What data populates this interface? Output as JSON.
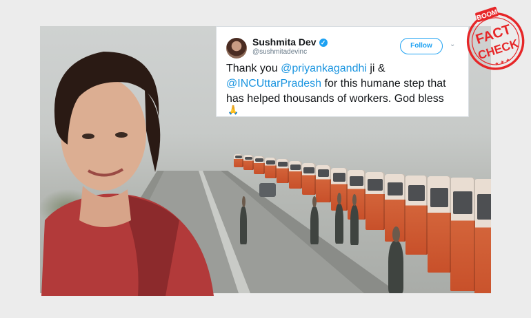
{
  "tweet": {
    "author_name": "Sushmita Dev",
    "author_handle": "@sushmitadevinc",
    "follow_label": "Follow",
    "text_parts": {
      "intro": "Thank you ",
      "mention_1": "@priyankagandhi",
      "middle": " ji & ",
      "mention_2": "@INCUttarPradesh",
      "ending": " for this humane step that has helped thousands of workers. God bless"
    },
    "emoji": "🙏"
  },
  "stamp": {
    "brand": "BOOM",
    "line_1": "FACT",
    "line_2": "CHECK"
  },
  "colors": {
    "mention": "#1b95e0",
    "stamp_red": "#e62628",
    "follow_blue": "#1da1f2"
  }
}
